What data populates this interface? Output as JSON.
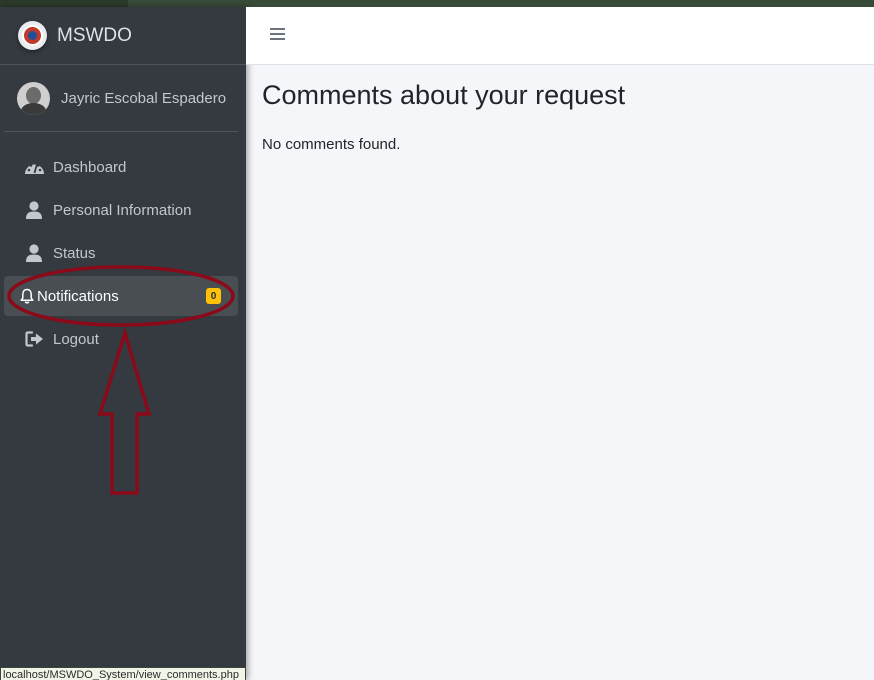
{
  "brand": {
    "name": "MSWDO"
  },
  "user": {
    "name": "Jayric Escobal Espadero"
  },
  "sidebar": {
    "items": [
      {
        "label": "Dashboard",
        "icon": "tachometer-icon"
      },
      {
        "label": "Personal Information",
        "icon": "user-icon"
      },
      {
        "label": "Status",
        "icon": "user-icon"
      },
      {
        "label": "Notifications",
        "icon": "bell-icon",
        "badge": "0",
        "active": true
      },
      {
        "label": "Logout",
        "icon": "sign-out-icon"
      }
    ]
  },
  "main": {
    "title": "Comments about your request",
    "empty_message": "No comments found."
  },
  "status_bar": {
    "url": "localhost/MSWDO_System/view_comments.php"
  },
  "colors": {
    "sidebar_bg": "#343a40",
    "active_item_bg": "#494e53",
    "badge": "#ffc107",
    "annotation": "#8b0a1a"
  }
}
